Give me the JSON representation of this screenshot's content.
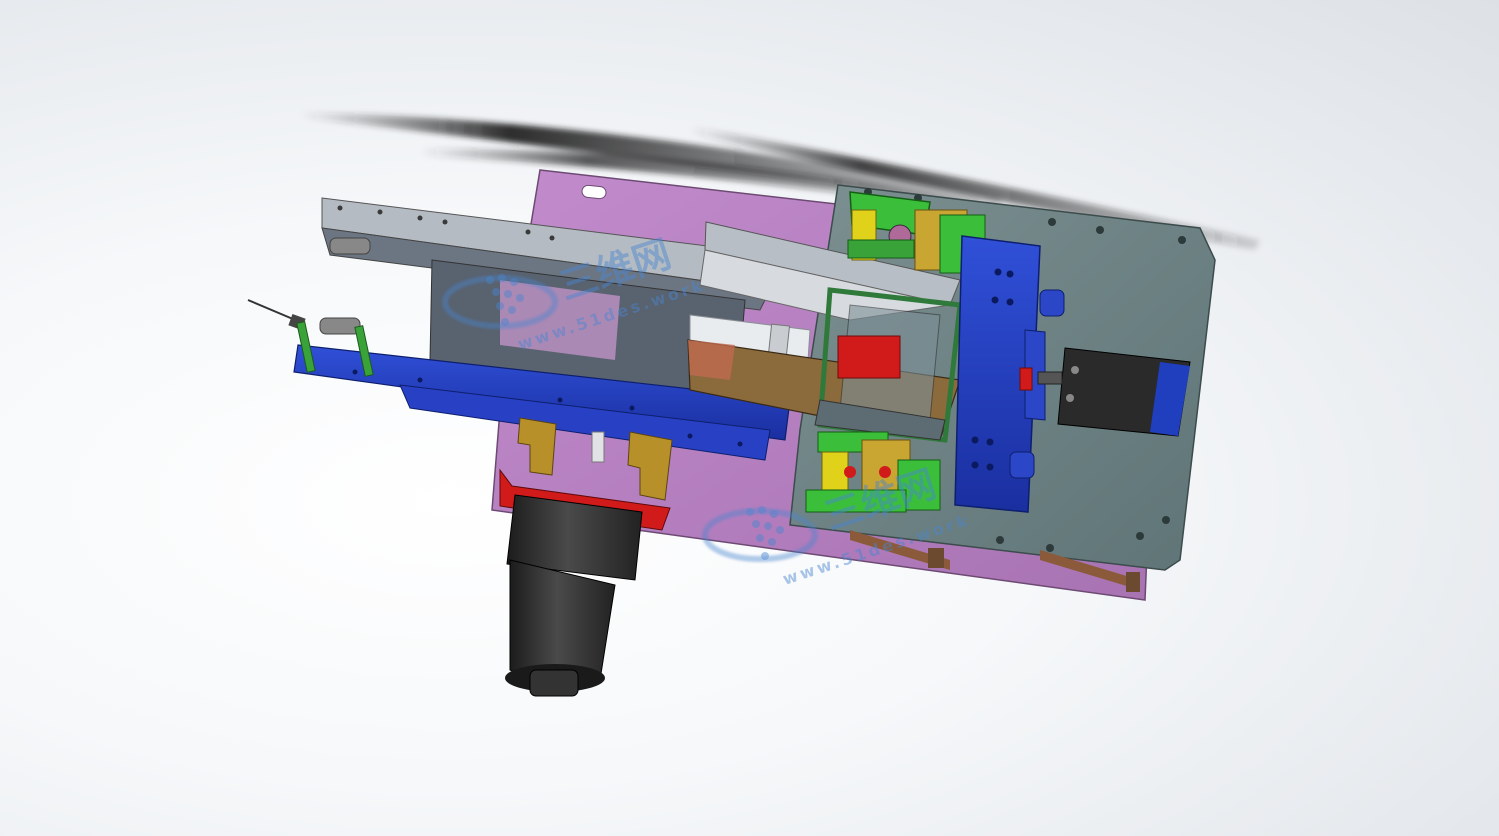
{
  "viewer": {
    "background": "#eef1f4",
    "model": "cad-assembly"
  },
  "watermark": {
    "site_text": "www.51des.work",
    "cn_text": "三维网",
    "color": "#4a86cf"
  },
  "colors": {
    "base_plate": "#b07ab8",
    "gray_plate": "#6f8486",
    "blue_rail": "#1f3fbf",
    "motor": "#2e2e2e",
    "red_block": "#d11a1a",
    "gold_bracket": "#b8902a",
    "green_link": "#3bbf3b",
    "yellow_bracket": "#e0d21a",
    "brown_plate": "#8a6a3a",
    "frame_gray": "#8e96a0"
  }
}
